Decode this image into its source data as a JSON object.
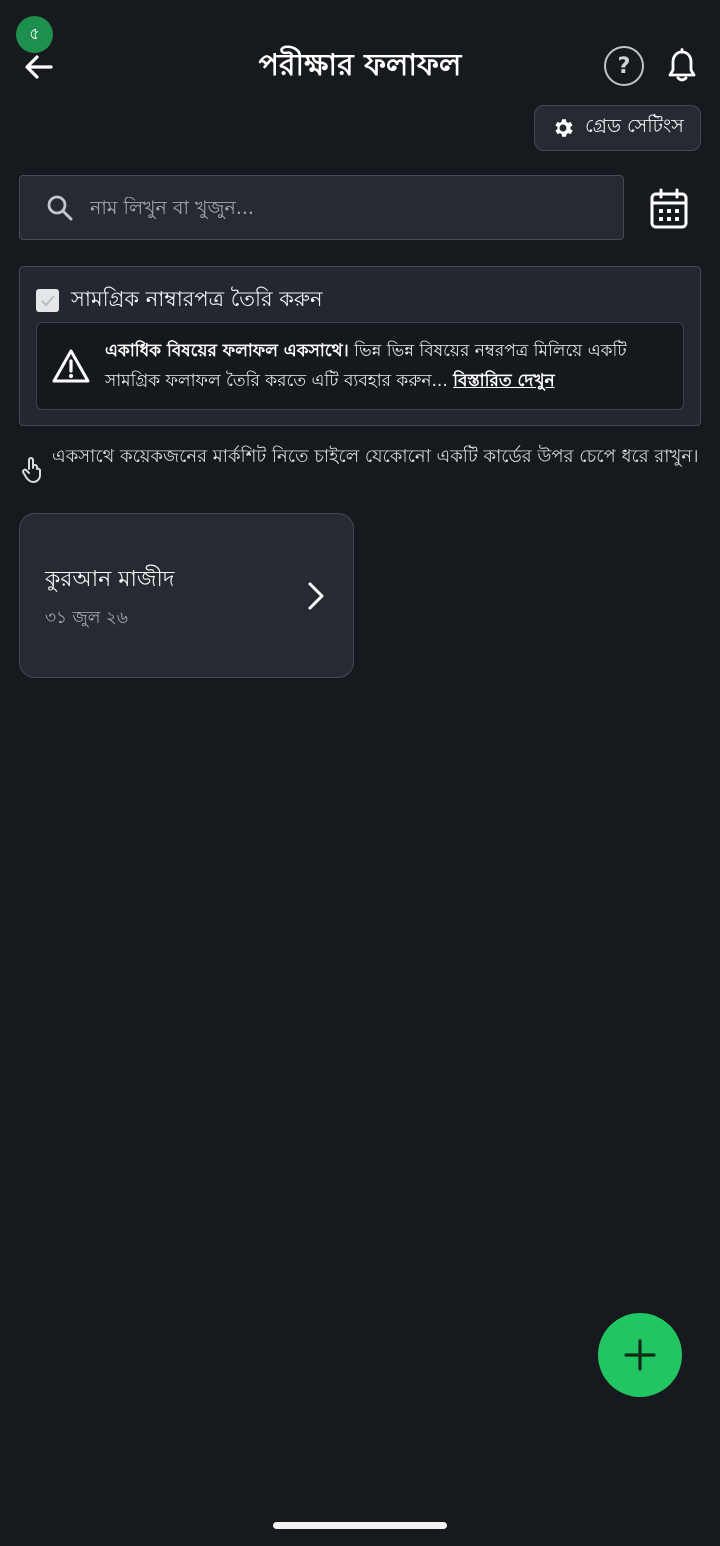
{
  "status": {
    "indicator_glyph": "৫"
  },
  "header": {
    "title": "পরীক্ষার ফলাফল",
    "help_glyph": "?",
    "icons": {
      "back": "arrow-left-icon",
      "help": "help-circle-icon",
      "bell": "bell-icon"
    }
  },
  "grade_settings": {
    "label": "গ্রেড সেটিংস",
    "icon": "gear-icon"
  },
  "search": {
    "placeholder": "নাম লিখুন বা খুজুন...",
    "value": "",
    "calendar_icon": "calendar-icon"
  },
  "combined": {
    "checkbox_label": "সামগ্রিক নাম্বারপত্র তৈরি করুন",
    "checked": false,
    "info_bold": "একাধিক বিষয়ের ফলাফল একসাথে।",
    "info_text": " ভিন্ন ভিন্ন বিষয়ের নম্বরপত্র মিলিয়ে একটি সামগ্রিক ফলাফল তৈরি করতে এটি ব্যবহার করুন... ",
    "info_link": "বিস্তারিত দেখুন"
  },
  "hint": {
    "text": "একসাথে কয়েকজনের মার্কশিট নিতে চাইলে যেকোনো একটি কার্ডের উপর চেপে ধরে রাখুন।"
  },
  "results": [
    {
      "title": "কুরআন মাজীদ",
      "date": "৩১ জুল ২৬"
    }
  ],
  "colors": {
    "background": "#16191d",
    "surface": "#262b32",
    "fab": "#21c562",
    "border": "#444b54"
  }
}
